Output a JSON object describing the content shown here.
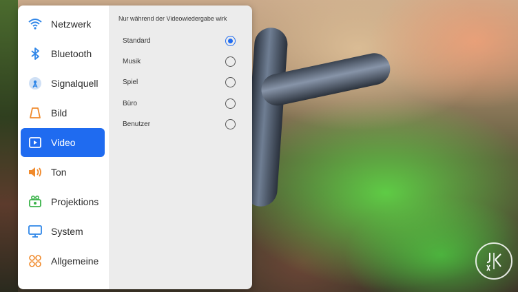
{
  "sidebar": {
    "items": [
      {
        "label": "Netzwerk",
        "icon": "wifi-icon"
      },
      {
        "label": "Bluetooth",
        "icon": "bluetooth-icon"
      },
      {
        "label": "Signalquell",
        "icon": "signal-source-icon"
      },
      {
        "label": "Bild",
        "icon": "picture-icon"
      },
      {
        "label": "Video",
        "icon": "video-icon",
        "active": true
      },
      {
        "label": "Ton",
        "icon": "speaker-icon"
      },
      {
        "label": "Projektions",
        "icon": "projector-icon"
      },
      {
        "label": "System",
        "icon": "monitor-icon"
      },
      {
        "label": "Allgemeine",
        "icon": "grid-icon"
      }
    ]
  },
  "content": {
    "title": "Nur während der Videowiedergabe wirk",
    "options": [
      {
        "label": "Standard",
        "checked": true
      },
      {
        "label": "Musik",
        "checked": false
      },
      {
        "label": "Spiel",
        "checked": false
      },
      {
        "label": "Büro",
        "checked": false
      },
      {
        "label": "Benutzer",
        "checked": false
      }
    ]
  },
  "colors": {
    "accent": "#1f6bf0",
    "icon_blue": "#2f86e8",
    "icon_orange": "#f08a2c",
    "icon_green": "#3bb34a",
    "icon_pink": "#e85a8a"
  }
}
